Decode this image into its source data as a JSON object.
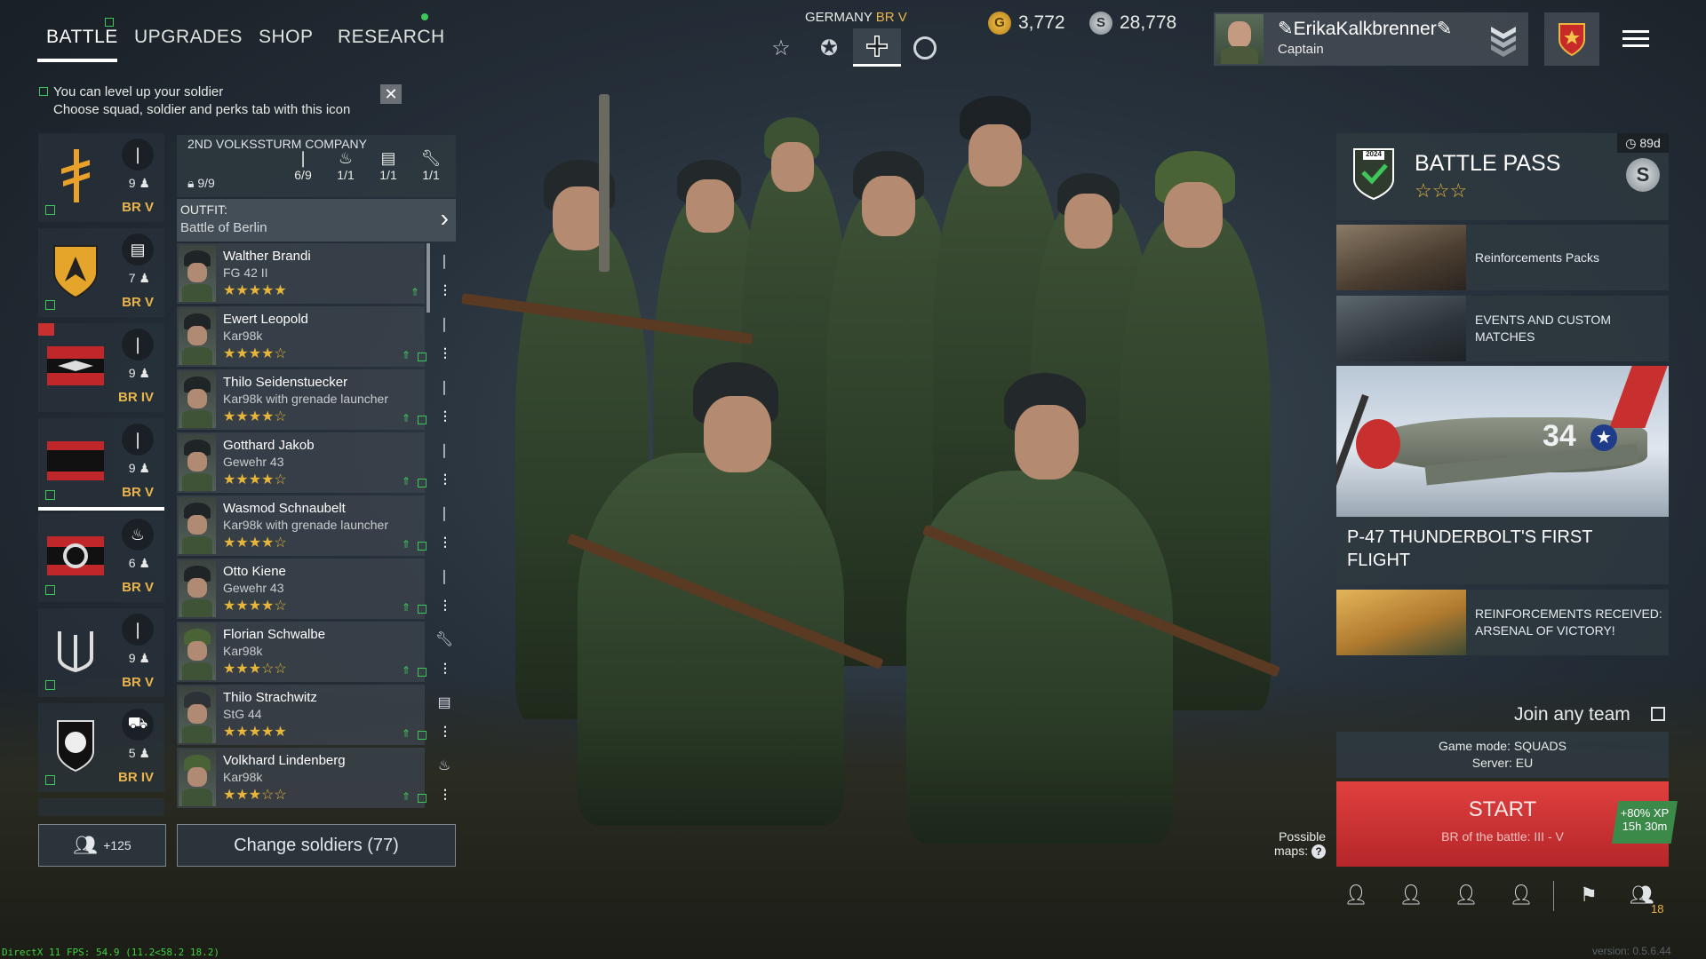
{
  "nav": {
    "tabs": [
      "BATTLE",
      "UPGRADES",
      "SHOP",
      "RESEARCH"
    ],
    "active_tab": "BATTLE"
  },
  "hint": {
    "line1": "You can level up your soldier",
    "line2": "Choose squad, soldier and perks tab with this icon",
    "close": "✕"
  },
  "header": {
    "nation": "GERMANY",
    "nation_br": "BR V",
    "gold_value": "3,772",
    "silver_value": "28,778",
    "player_name": "ErikaKalkbrenner",
    "player_rank": "Captain"
  },
  "squads": [
    {
      "count": "9",
      "br": "BR V",
      "class_icon": "rifle-icon",
      "emblem": "rune-emblem"
    },
    {
      "count": "7",
      "br": "BR V",
      "class_icon": "list-icon",
      "emblem": "shield-emblem"
    },
    {
      "count": "9",
      "br": "BR IV",
      "class_icon": "rifle-icon",
      "emblem": "banner-emblem"
    },
    {
      "count": "9",
      "br": "BR V",
      "class_icon": "rifle-icon",
      "emblem": "stripe-emblem"
    },
    {
      "count": "6",
      "br": "BR V",
      "class_icon": "flame-icon",
      "emblem": "iron-cross-emblem"
    },
    {
      "count": "9",
      "br": "BR V",
      "class_icon": "rifle-icon",
      "emblem": "anchor-emblem"
    },
    {
      "count": "5",
      "br": "BR IV",
      "class_icon": "tank-icon",
      "emblem": "badge-emblem"
    }
  ],
  "squad_header": {
    "title": "2ND VOLKSSTURM COMPANY",
    "total": "9/9",
    "slots": [
      "6/9",
      "1/1",
      "1/1",
      "1/1"
    ]
  },
  "outfit": {
    "label": "OUTFIT:",
    "value": "Battle of Berlin"
  },
  "soldiers": [
    {
      "name": "Walther Brandi",
      "weapon": "FG 42 II",
      "stars": "★★★★★"
    },
    {
      "name": "Ewert Leopold",
      "weapon": "Kar98k",
      "stars": "★★★★☆"
    },
    {
      "name": "Thilo Seidenstuecker",
      "weapon": "Kar98k with grenade launcher",
      "stars": "★★★★☆"
    },
    {
      "name": "Gotthard Jakob",
      "weapon": "Gewehr 43",
      "stars": "★★★★☆"
    },
    {
      "name": "Wasmod Schnaubelt",
      "weapon": "Kar98k with grenade launcher",
      "stars": "★★★★☆"
    },
    {
      "name": "Otto Kiene",
      "weapon": "Gewehr 43",
      "stars": "★★★★☆"
    },
    {
      "name": "Florian Schwalbe",
      "weapon": "Kar98k",
      "stars": "★★★☆☆"
    },
    {
      "name": "Thilo Strachwitz",
      "weapon": "StG 44",
      "stars": "★★★★★"
    },
    {
      "name": "Volkhard Lindenberg",
      "weapon": "Kar98k",
      "stars": "★★★☆☆"
    }
  ],
  "bottom_left": {
    "reserve": "+125",
    "change_soldiers": "Change soldiers (77)"
  },
  "battle_pass": {
    "title": "BATTLE PASS",
    "timer": "89d",
    "stars": "☆☆☆",
    "badge_year": "2024"
  },
  "news": {
    "reinforcements": "Reinforcements Packs",
    "events_line1": "EVENTS AND CUSTOM",
    "events_line2": "MATCHES",
    "plane_number": "34",
    "feature_line1": "P-47 THUNDERBOLT'S FIRST",
    "feature_line2": "FLIGHT",
    "received_line1": "REINFORCEMENTS RECEIVED:",
    "received_line2": "ARSENAL OF VICTORY!"
  },
  "match": {
    "join_any_team": "Join any team",
    "game_mode": "Game mode: SQUADS",
    "server": "Server: EU",
    "start": "START",
    "br_range": "BR of the battle: III - V",
    "xp_bonus": "+80% XP",
    "xp_time": "15h 30m",
    "possible": "Possible",
    "maps": "maps:",
    "friends_count": "18"
  },
  "footer": {
    "debug": "DirectX 11 FPS: 54.9 (11.2<58.2 18.2)",
    "version": "version: 0.5.6.44"
  },
  "colors": {
    "br_gold": "#e9b44c",
    "star_gold": "#e6b53a",
    "green_indicator": "#3ec65a",
    "start_red": "#c8302f"
  }
}
